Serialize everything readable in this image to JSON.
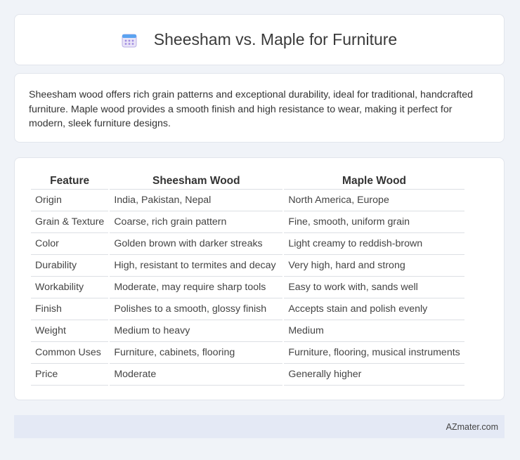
{
  "header": {
    "icon": "calendar-icon",
    "title": "Sheesham vs. Maple for Furniture"
  },
  "intro": {
    "text": "Sheesham wood offers rich grain patterns and exceptional durability, ideal for traditional, handcrafted furniture. Maple wood provides a smooth finish and high resistance to wear, making it perfect for modern, sleek furniture designs."
  },
  "table": {
    "headers": [
      "Feature",
      "Sheesham Wood",
      "Maple Wood"
    ],
    "rows": [
      [
        "Origin",
        "India, Pakistan, Nepal",
        "North America, Europe"
      ],
      [
        "Grain & Texture",
        "Coarse, rich grain pattern",
        "Fine, smooth, uniform grain"
      ],
      [
        "Color",
        "Golden brown with darker streaks",
        "Light creamy to reddish-brown"
      ],
      [
        "Durability",
        "High, resistant to termites and decay",
        "Very high, hard and strong"
      ],
      [
        "Workability",
        "Moderate, may require sharp tools",
        "Easy to work with, sands well"
      ],
      [
        "Finish",
        "Polishes to a smooth, glossy finish",
        "Accepts stain and polish evenly"
      ],
      [
        "Weight",
        "Medium to heavy",
        "Medium"
      ],
      [
        "Common Uses",
        "Furniture, cabinets, flooring",
        "Furniture, flooring, musical instruments"
      ],
      [
        "Price",
        "Moderate",
        "Generally higher"
      ]
    ]
  },
  "footer": {
    "brand": "AZmater.com"
  }
}
